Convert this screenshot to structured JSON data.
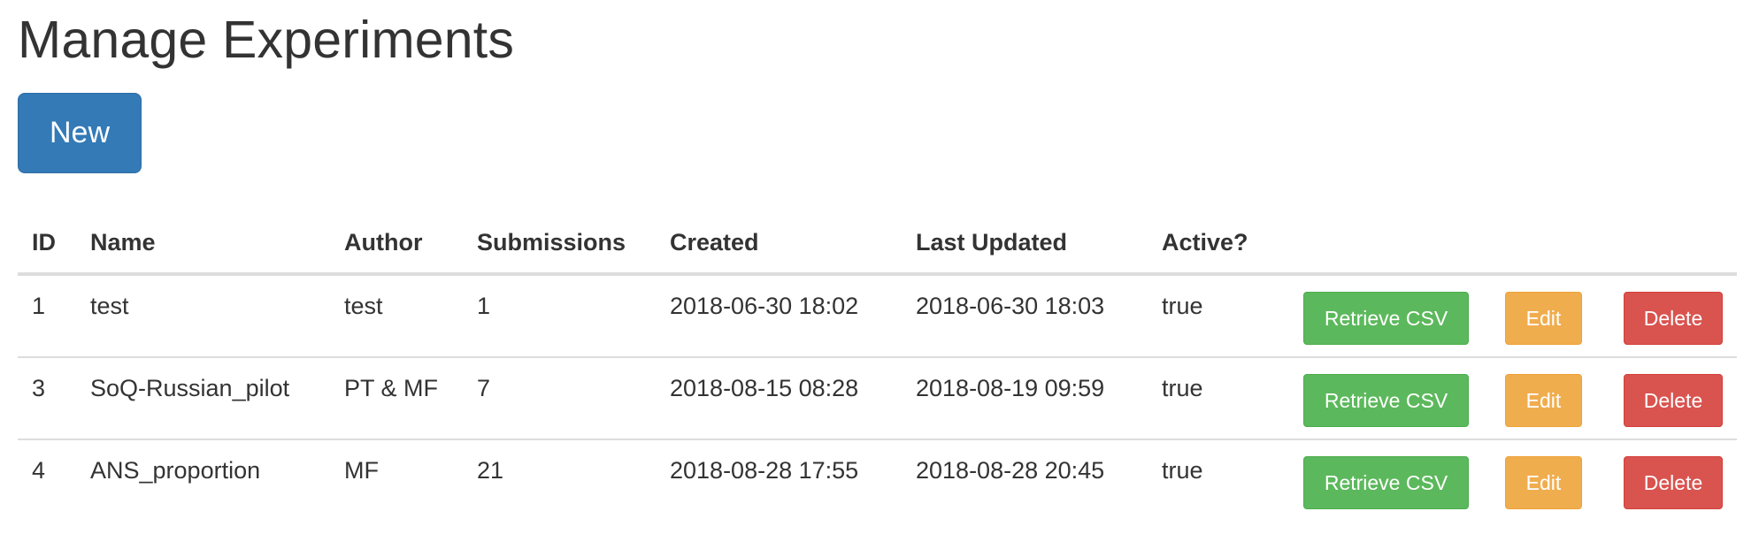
{
  "page": {
    "title": "Manage Experiments",
    "new_button_label": "New"
  },
  "colors": {
    "primary": "#337ab7",
    "success": "#5cb85c",
    "warning": "#f0ad4e",
    "danger": "#d9534f",
    "text": "#333333",
    "border": "#dddddd"
  },
  "table": {
    "headers": {
      "id": "ID",
      "name": "Name",
      "author": "Author",
      "submissions": "Submissions",
      "created": "Created",
      "last_updated": "Last Updated",
      "active": "Active?"
    },
    "rows": [
      {
        "id": "1",
        "name": "test",
        "author": "test",
        "submissions": "1",
        "created": "2018-06-30 18:02",
        "last_updated": "2018-06-30 18:03",
        "active": "true",
        "actions": {
          "retrieve_csv": "Retrieve CSV",
          "edit": "Edit",
          "delete": "Delete"
        }
      },
      {
        "id": "3",
        "name": "SoQ-Russian_pilot",
        "author": "PT & MF",
        "submissions": "7",
        "created": "2018-08-15 08:28",
        "last_updated": "2018-08-19 09:59",
        "active": "true",
        "actions": {
          "retrieve_csv": "Retrieve CSV",
          "edit": "Edit",
          "delete": "Delete"
        }
      },
      {
        "id": "4",
        "name": "ANS_proportion",
        "author": "MF",
        "submissions": "21",
        "created": "2018-08-28 17:55",
        "last_updated": "2018-08-28 20:45",
        "active": "true",
        "actions": {
          "retrieve_csv": "Retrieve CSV",
          "edit": "Edit",
          "delete": "Delete"
        }
      }
    ]
  }
}
